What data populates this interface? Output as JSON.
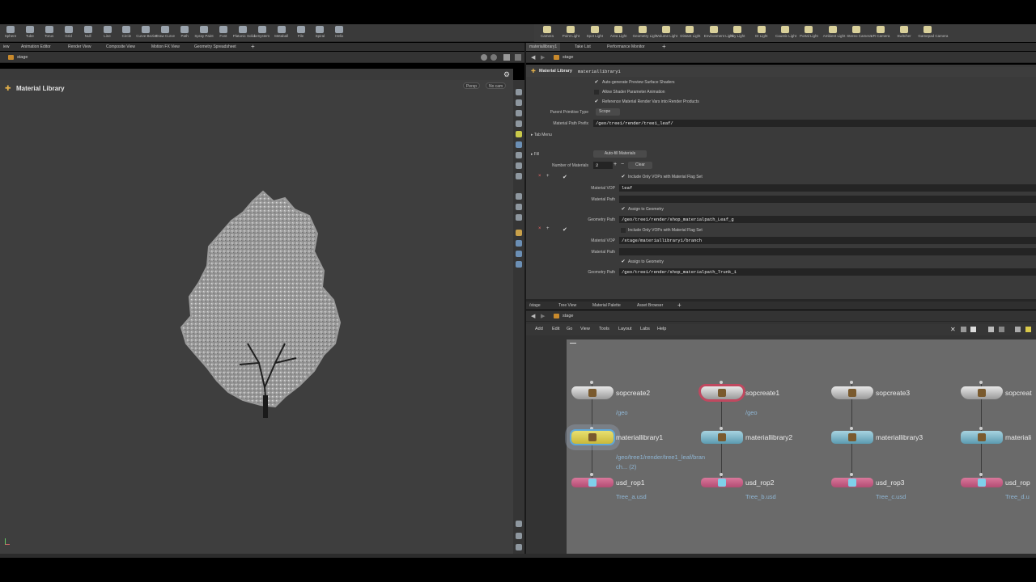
{
  "shelf": {
    "left_tools": [
      "Sphere",
      "Tube",
      "Torus",
      "Grid",
      "Null",
      "Line",
      "Circle",
      "Curve Bezier",
      "Draw Curve",
      "Path",
      "Spray Paint",
      "Font",
      "Platonic Solids",
      "L-System",
      "Metaball",
      "File",
      "Spiral",
      "Helix"
    ],
    "right_tools": [
      "Camera",
      "Point Light",
      "Spot Light",
      "Area Light",
      "Geometry Light",
      "Volume Light",
      "Distant Light",
      "Environment Light",
      "Sky Light",
      "GI Light",
      "Caustic Light",
      "Portal Light",
      "Ambient Light",
      "Stereo Camera",
      "VR Camera",
      "Switcher",
      "Gamepad Camera"
    ]
  },
  "left_tabs": [
    "iew",
    "Animation Editor",
    "Render View",
    "Composite View",
    "Motion FX View",
    "Geometry Spreadsheet"
  ],
  "left_path": "stage",
  "viewport": {
    "title": "Material Library",
    "persp_label": "Persp",
    "cam_label": "No cam"
  },
  "right_tabs": [
    "materiallibrary1",
    "Take List",
    "Performance Monitor"
  ],
  "right_path": "stage",
  "params": {
    "node_type": "Material Library",
    "node_name": "materiallibrary1",
    "opt1": "Auto-generate Preview Surface Shaders",
    "opt2": "Allow Shader Parameter Animation",
    "opt3": "Reference Material Render Vars into Render Products",
    "parent_prim_label": "Parent Primitive Type",
    "parent_prim_value": "Scope",
    "mat_prefix_label": "Material Path Prefix",
    "mat_prefix_value": "/geo/tree1/render/tree1_leaf/",
    "tab_menu": "Tab Menu",
    "fill": "Fill",
    "autofill": "Auto-fill Materials",
    "num_mats_label": "Number of Materials",
    "num_mats_value": "2",
    "clear": "Clear",
    "include_only": "Include Only VOPs with Material Flag Set",
    "mat_vop_label": "Material VOP",
    "mat_path_label": "Material Path",
    "assign_geo": "Assign to Geometry",
    "geo_path_label": "Geometry Path",
    "m1_vop": "leaf",
    "m1_geo": "/geo/tree1/render/shop_materialpath_Leaf_g",
    "m2_vop": "/stage/materiallibrary1/branch",
    "m2_geo": "/geo/tree1/render/shop_materialpath_Trunk_1"
  },
  "net_tabs": [
    "/stage",
    "Tree View",
    "Material Palette",
    "Asset Browser"
  ],
  "net_path": "stage",
  "net_menu": [
    "Add",
    "Edit",
    "Go",
    "View",
    "Tools",
    "Layout",
    "Labs",
    "Help"
  ],
  "nodes": {
    "sop": [
      {
        "name": "sopcreate2",
        "sub": "/geo"
      },
      {
        "name": "sopcreate1",
        "sub": "/geo"
      },
      {
        "name": "sopcreate3",
        "sub": ""
      },
      {
        "name": "sopcreat",
        "sub": ""
      }
    ],
    "mat": [
      {
        "name": "materiallibrary1",
        "sub": "/geo/tree1/render/tree1_leaf/bran",
        "sub2": "ch... (2)"
      },
      {
        "name": "materiallibrary2"
      },
      {
        "name": "materiallibrary3"
      },
      {
        "name": "materiali"
      }
    ],
    "rop": [
      {
        "name": "usd_rop1",
        "sub": "Tree_a.usd"
      },
      {
        "name": "usd_rop2",
        "sub": "Tree_b.usd"
      },
      {
        "name": "usd_rop3",
        "sub": "Tree_c.usd"
      },
      {
        "name": "usd_rop",
        "sub": "Tree_d.u"
      }
    ]
  }
}
